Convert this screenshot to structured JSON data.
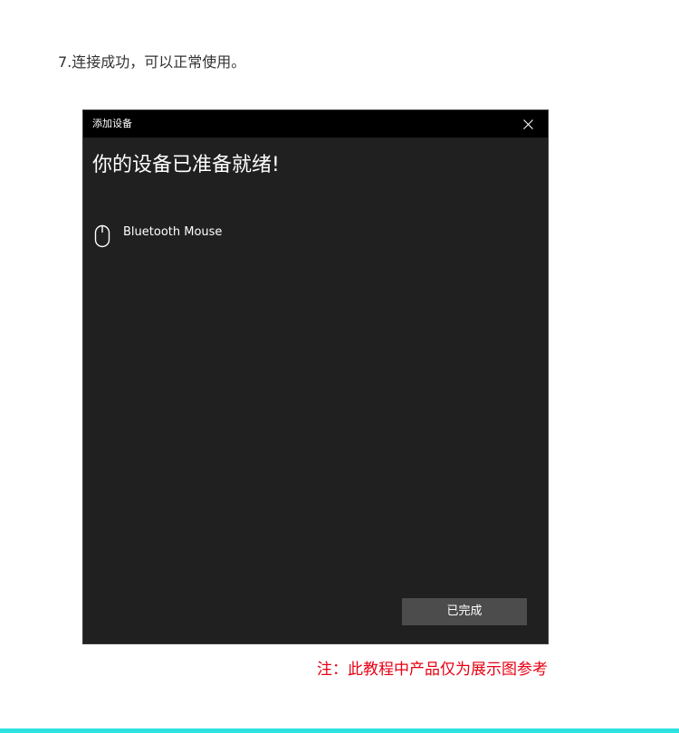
{
  "step": {
    "text": "7.连接成功，可以正常使用。"
  },
  "dialog": {
    "title": "添加设备",
    "close_icon": "close-icon",
    "heading": "你的设备已准备就绪!",
    "device": {
      "icon": "mouse-icon",
      "name": "Bluetooth Mouse"
    },
    "done_label": "已完成"
  },
  "note": {
    "text": "注：此教程中产品仅为展示图参考"
  },
  "colors": {
    "dialog_background": "#202020",
    "titlebar_background": "#000000",
    "button_background": "#4c4c4c",
    "note_color": "#e60012",
    "accent_bar": "#2de3e0"
  }
}
